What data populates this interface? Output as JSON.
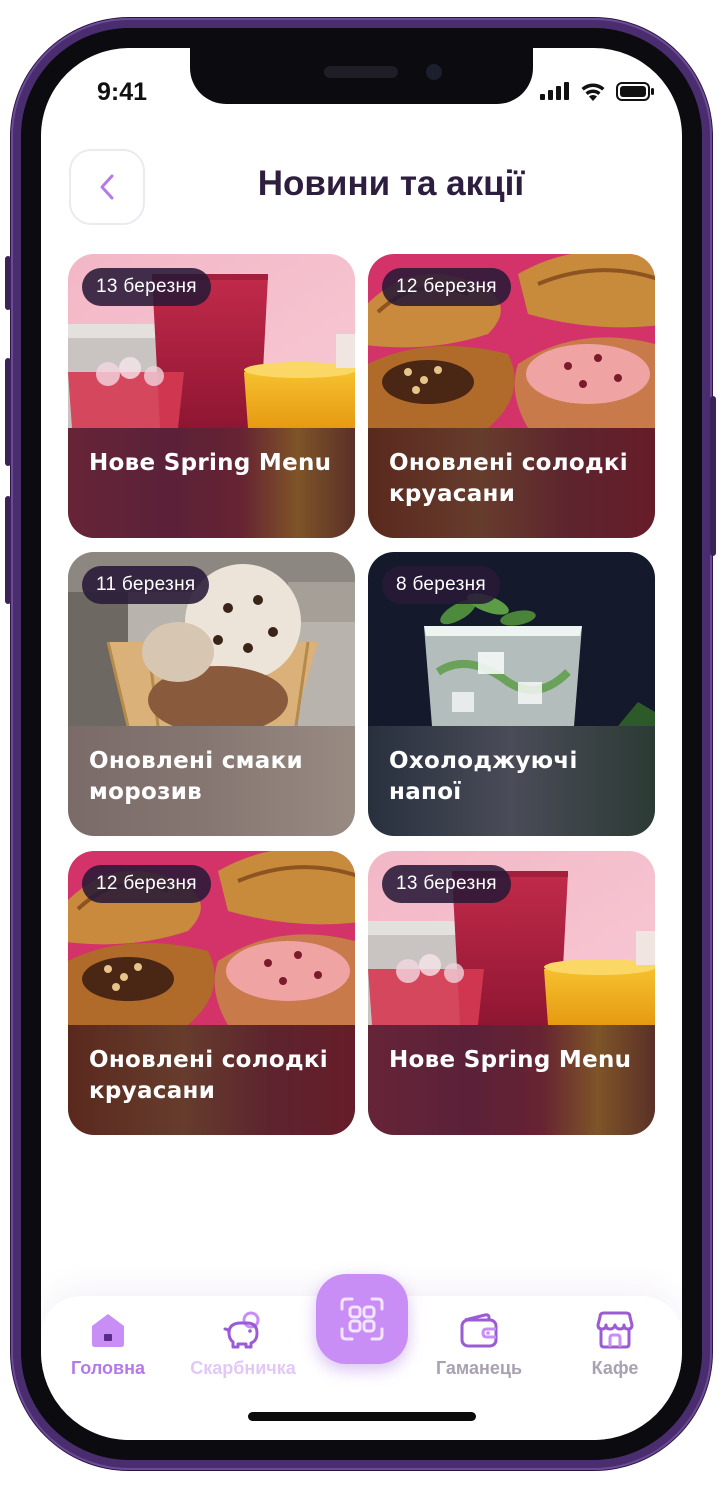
{
  "status_bar": {
    "time": "9:41"
  },
  "header": {
    "title": "Новини та акції"
  },
  "cards": [
    {
      "date": "13 березня",
      "title": "Нове Spring Menu",
      "image": "spring-menu-drinks"
    },
    {
      "date": "12 березня",
      "title": "Оновлені солодкі круасани",
      "image": "croissants"
    },
    {
      "date": "11 березня",
      "title": "Оновлені смаки морозив",
      "image": "ice-cream"
    },
    {
      "date": "8 березня",
      "title": "Охолоджуючі напої",
      "image": "cold-drink-mint"
    },
    {
      "date": "12 березня",
      "title": "Оновлені солодкі круасани",
      "image": "croissants"
    },
    {
      "date": "13 березня",
      "title": "Нове Spring Menu",
      "image": "spring-menu-drinks"
    }
  ],
  "nav": {
    "items": [
      {
        "label": "Головна",
        "icon": "home-icon",
        "active": true
      },
      {
        "label": "Скарбничка",
        "icon": "piggy-bank-icon",
        "active": false
      },
      {
        "label": "Гаманець",
        "icon": "wallet-icon",
        "active": false
      },
      {
        "label": "Кафе",
        "icon": "cafe-icon",
        "active": false
      }
    ],
    "center_icon": "scan-icon"
  },
  "colors": {
    "accent": "#c88ef5",
    "accent_dark": "#9b5bd4",
    "title": "#2d1d3e",
    "nav_inactive": "#a9a2b2",
    "frame": "#4a2d6e"
  }
}
